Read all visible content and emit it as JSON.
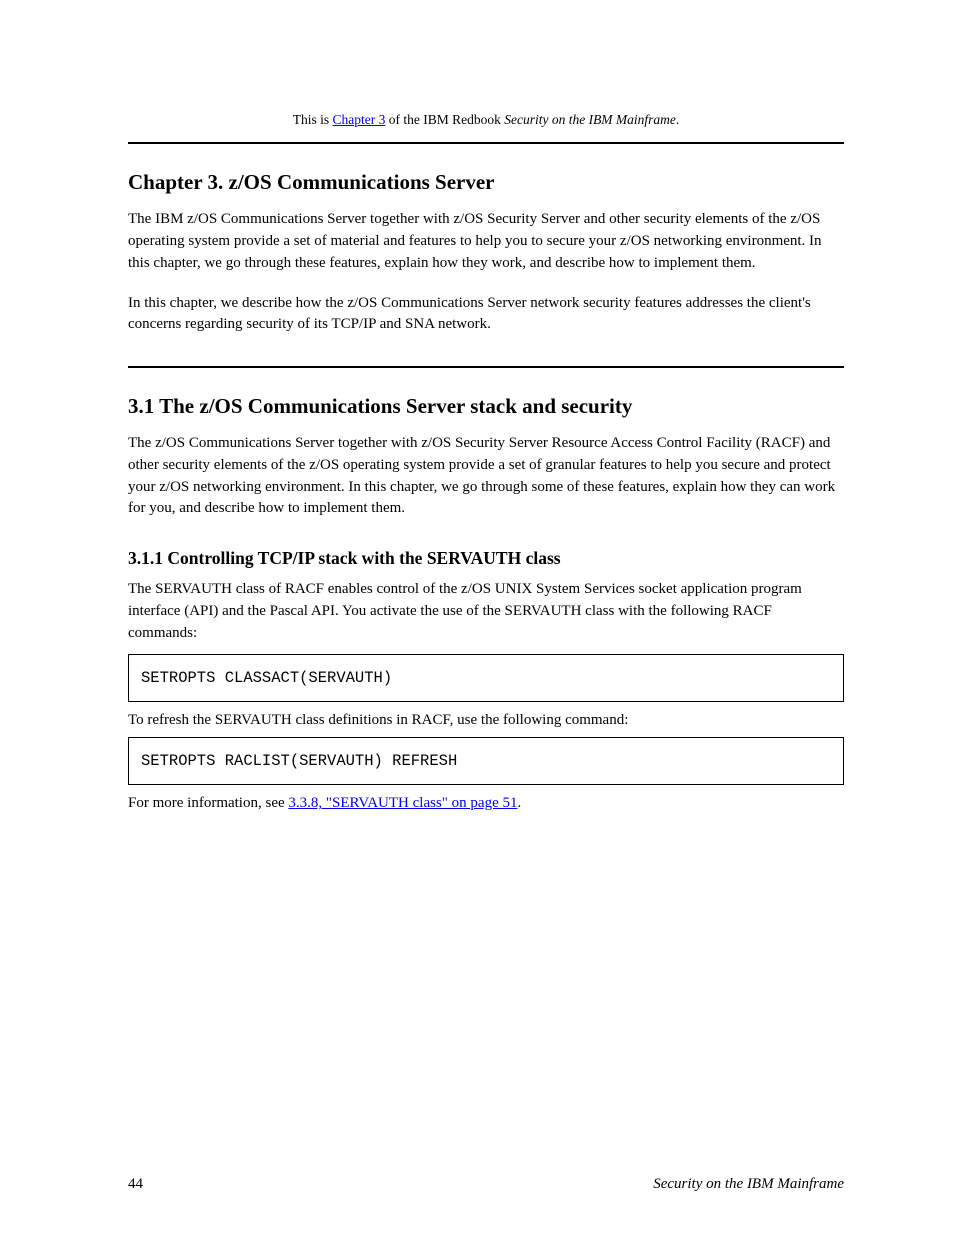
{
  "topnote": {
    "prefix": "This is ",
    "linktext": "Chapter 3",
    "suffix1": " of the IBM Redbook ",
    "booktitle": "Security on the IBM Mainframe",
    "suffix2": "."
  },
  "section1": {
    "title": "Chapter 3.  z/OS Communications Server",
    "para1": "The IBM z/OS Communications Server together with z/OS Security Server and other security elements of the z/OS operating system provide a set of material and features to help you to secure your z/OS networking environment. In this chapter, we go through these features, explain how they work, and describe how to implement them.",
    "para2": "In this chapter, we describe how the z/OS Communications Server network security features addresses the client's concerns regarding security of its TCP/IP and SNA network."
  },
  "section2": {
    "title": "3.1  The z/OS Communications Server stack and security",
    "para1": "The z/OS Communications Server together with z/OS Security Server Resource Access Control Facility (RACF) and other security elements of the z/OS operating system provide a set of granular features to help you secure and protect your z/OS networking environment. In this chapter, we go through some of these features, explain how they can work for you, and describe how to implement them.",
    "subhead": "3.1.1  Controlling TCP/IP stack with the SERVAUTH class",
    "para2": "The SERVAUTH class of RACF enables control of the z/OS UNIX System Services socket application program interface (API) and the Pascal API. You activate the use of the SERVAUTH class with the following RACF commands:",
    "cmd1": "SETROPTS CLASSACT(SERVAUTH)",
    "cmd2intro": "To refresh the SERVAUTH class definitions in RACF, use the following command:",
    "cmd2": "SETROPTS RACLIST(SERVAUTH) REFRESH",
    "para3prefix": "For more information, see ",
    "para3link": "3.3.8, \"SERVAUTH class\" on page 51",
    "para3suffix": "."
  },
  "footer": {
    "pagenum": "44",
    "text": "Security on the IBM Mainframe"
  }
}
